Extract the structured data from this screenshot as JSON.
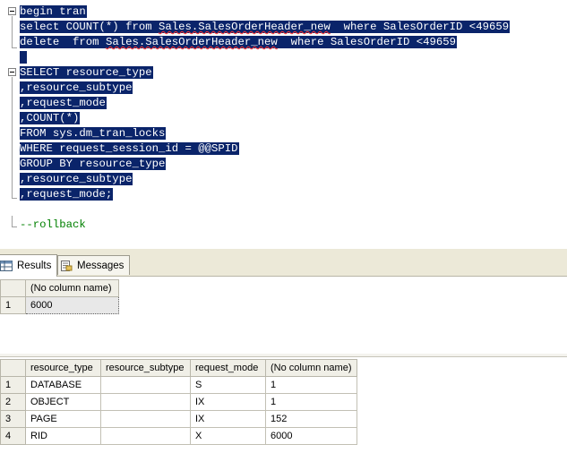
{
  "editor": {
    "lines": [
      "begin tran",
      "select COUNT(*) from Sales.SalesOrderHeader_new  where SalesOrderID <49659",
      "delete  from Sales.SalesOrderHeader_new  where SalesOrderID <49659",
      "",
      "SELECT resource_type",
      ",resource_subtype",
      ",request_mode",
      ",COUNT(*)",
      "FROM sys.dm_tran_locks",
      "WHERE request_session_id = @@SPID",
      "GROUP BY resource_type",
      ",resource_subtype",
      ",request_mode;",
      "",
      "--rollback"
    ],
    "selection_color": "#0a246a",
    "comment_color": "#008000"
  },
  "tabs": [
    {
      "label": "Results",
      "icon": "grid-icon",
      "active": true
    },
    {
      "label": "Messages",
      "icon": "messages-icon",
      "active": false
    }
  ],
  "grid1": {
    "columns": [
      "(No column name)"
    ],
    "rows": [
      {
        "num": "1",
        "cells": [
          "6000"
        ]
      }
    ]
  },
  "grid2": {
    "columns": [
      "resource_type",
      "resource_subtype",
      "request_mode",
      "(No column name)"
    ],
    "rows": [
      {
        "num": "1",
        "cells": [
          "DATABASE",
          "",
          "S",
          "1"
        ]
      },
      {
        "num": "2",
        "cells": [
          "OBJECT",
          "",
          "IX",
          "1"
        ]
      },
      {
        "num": "3",
        "cells": [
          "PAGE",
          "",
          "IX",
          "152"
        ]
      },
      {
        "num": "4",
        "cells": [
          "RID",
          "",
          "X",
          "6000"
        ]
      }
    ]
  }
}
